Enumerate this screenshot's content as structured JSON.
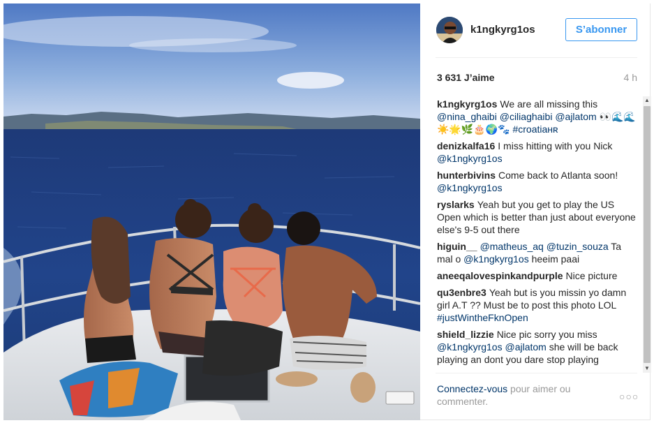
{
  "header": {
    "username": "k1ngkyrg1os",
    "follow_label": "S’abonner"
  },
  "stats": {
    "likes": "3 631 J’aime",
    "time": "4 h"
  },
  "comments": [
    {
      "author": "k1ngkyrg1os",
      "parts": [
        {
          "type": "text",
          "value": "We are all missing this "
        },
        {
          "type": "mention",
          "value": "@nina_ghaibi"
        },
        {
          "type": "text",
          "value": " "
        },
        {
          "type": "mention",
          "value": "@ciliaghaibi"
        },
        {
          "type": "text",
          "value": " "
        },
        {
          "type": "mention",
          "value": "@ajlatom"
        },
        {
          "type": "text",
          "value": " 👀🌊🌊☀️🌟🌿🎂🌍🐾 "
        },
        {
          "type": "tag",
          "value": "#croatiaʜʀ"
        }
      ]
    },
    {
      "author": "denizkalfa16",
      "parts": [
        {
          "type": "text",
          "value": "I miss hitting with you Nick "
        },
        {
          "type": "mention",
          "value": "@k1ngkyrg1os"
        }
      ]
    },
    {
      "author": "hunterbivins",
      "parts": [
        {
          "type": "text",
          "value": "Come back to Atlanta soon! "
        },
        {
          "type": "mention",
          "value": "@k1ngkyrg1os"
        }
      ]
    },
    {
      "author": "ryslarks",
      "parts": [
        {
          "type": "text",
          "value": "Yeah but you get to play the US Open which is better than just about everyone else's 9-5 out there"
        }
      ]
    },
    {
      "author": "higuin__",
      "parts": [
        {
          "type": "mention",
          "value": "@matheus_aq"
        },
        {
          "type": "text",
          "value": " "
        },
        {
          "type": "mention",
          "value": "@tuzin_souza"
        },
        {
          "type": "text",
          "value": " Ta mal o "
        },
        {
          "type": "mention",
          "value": "@k1ngkyrg1os"
        },
        {
          "type": "text",
          "value": " heeim paai"
        }
      ]
    },
    {
      "author": "aneeqalovespinkandpurple",
      "parts": [
        {
          "type": "text",
          "value": "Nice picture"
        }
      ]
    },
    {
      "author": "qu3enbre3",
      "parts": [
        {
          "type": "text",
          "value": "Yeah but is you missin yo damn girl A.T ?? Must be to post this photo LOL "
        },
        {
          "type": "tag",
          "value": "#justWintheFknOpen"
        }
      ]
    },
    {
      "author": "shield_lizzie",
      "parts": [
        {
          "type": "text",
          "value": "Nice pic sorry you miss "
        },
        {
          "type": "mention",
          "value": "@k1ngkyrg1os"
        },
        {
          "type": "text",
          "value": " "
        },
        {
          "type": "mention",
          "value": "@ajlatom"
        },
        {
          "type": "text",
          "value": " she will be back playing an dont you dare stop playing"
        }
      ]
    }
  ],
  "footer": {
    "login_link": "Connectez-vous",
    "text": " pour aimer ou commenter.",
    "more_label": "○○○"
  },
  "icons": {
    "scroll_up": "▲",
    "scroll_down": "▼"
  },
  "colors": {
    "accent": "#3897f0",
    "link": "#003569",
    "muted": "#999999",
    "text": "#262626"
  }
}
